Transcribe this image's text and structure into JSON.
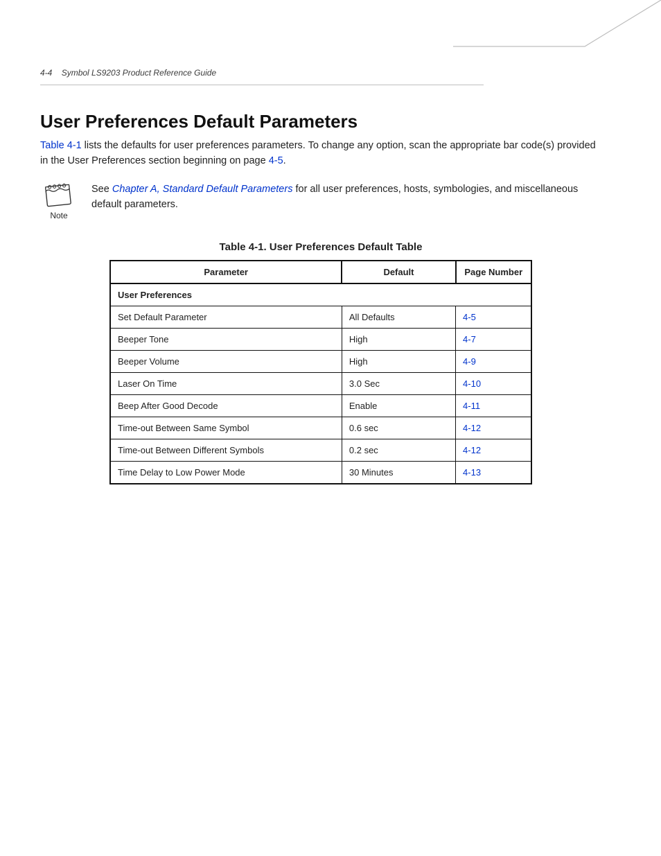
{
  "header": {
    "page_number": "4-4",
    "doc_title": "Symbol  LS9203 Product Reference Guide"
  },
  "heading": "User Preferences Default Parameters",
  "intro": {
    "link1": "Table 4-1",
    "text1": " lists the defaults for user preferences parameters. To change any option, scan the appropriate bar code(s) provided in the User Preferences section beginning on page ",
    "link2": "4-5",
    "text2": "."
  },
  "note": {
    "label": "Note",
    "prefix": "See ",
    "link": "Chapter A, Standard Default Parameters",
    "suffix": " for all user preferences, hosts, symbologies, and miscellaneous default parameters."
  },
  "table": {
    "caption": "Table 4-1.  User Preferences Default Table",
    "col_parameter": "Parameter",
    "col_default": "Default",
    "col_page": "Page Number",
    "section": "User Preferences",
    "rows": [
      {
        "param": "Set Default Parameter",
        "def": "All Defaults",
        "page": "4-5"
      },
      {
        "param": "Beeper Tone",
        "def": "High",
        "page": "4-7"
      },
      {
        "param": "Beeper Volume",
        "def": "High",
        "page": "4-9"
      },
      {
        "param": "Laser On Time",
        "def": "3.0 Sec",
        "page": "4-10"
      },
      {
        "param": "Beep After Good Decode",
        "def": "Enable",
        "page": "4-11"
      },
      {
        "param": "Time-out Between Same Symbol",
        "def": "0.6 sec",
        "page": "4-12"
      },
      {
        "param": "Time-out Between Different Symbols",
        "def": "0.2 sec",
        "page": "4-12"
      },
      {
        "param": "Time Delay to Low Power Mode",
        "def": "30 Minutes",
        "page": "4-13"
      }
    ]
  }
}
